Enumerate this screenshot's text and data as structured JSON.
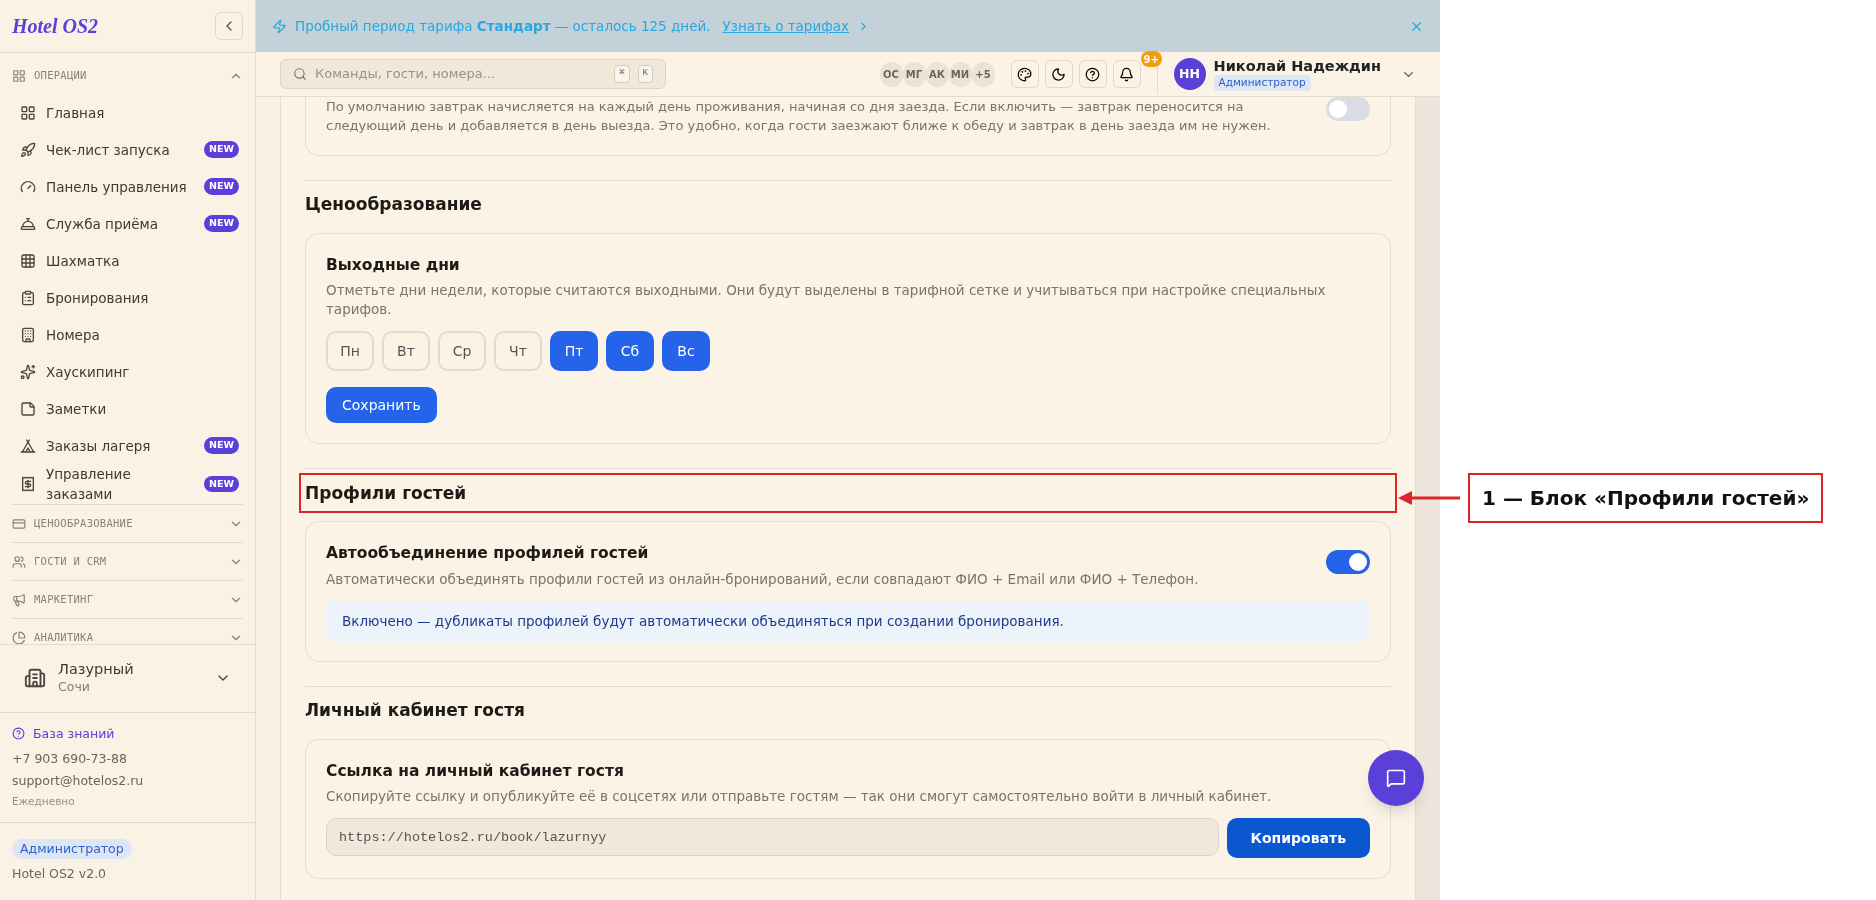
{
  "sidebar": {
    "logo": "Hotel OS2",
    "groups": [
      {
        "label": "ОПЕРАЦИИ",
        "expanded": true,
        "items": [
          {
            "label": "Главная"
          },
          {
            "label": "Чек-лист запуска",
            "badge": "NEW"
          },
          {
            "label": "Панель управления",
            "badge": "NEW"
          },
          {
            "label": "Служба приёма",
            "badge": "NEW"
          },
          {
            "label": "Шахматка"
          },
          {
            "label": "Бронирования"
          },
          {
            "label": "Номера"
          },
          {
            "label": "Хаускипинг"
          },
          {
            "label": "Заметки"
          },
          {
            "label": "Заказы лагеря",
            "badge": "NEW"
          },
          {
            "label": "Управление заказами",
            "badge": "NEW"
          }
        ]
      },
      {
        "label": "ЦЕНООБРАЗОВАНИЕ",
        "expanded": false
      },
      {
        "label": "ГОСТИ И CRM",
        "expanded": false
      },
      {
        "label": "МАРКЕТИНГ",
        "expanded": false
      },
      {
        "label": "АНАЛИТИКА",
        "expanded": false
      }
    ],
    "property": {
      "name": "Лазурный",
      "city": "Сочи"
    },
    "support": {
      "link": "База знаний",
      "phone": "+7 903 690-73-88",
      "email": "support@hotelos2.ru",
      "hours": "Ежедневно"
    },
    "role": "Администратор",
    "version": "Hotel OS2 v2.0"
  },
  "banner": {
    "text": "Пробный период тарифа **Стандарт** — осталось 125 дней.",
    "link": "Узнать о тарифах"
  },
  "header": {
    "search_placeholder": "Команды, гости, номера...",
    "shortcut": [
      "⌘",
      "K"
    ],
    "avatars": [
      "ОС",
      "МГ",
      "АК",
      "МИ",
      "+5"
    ],
    "notifications_badge": "9+",
    "user": {
      "initials": "НН",
      "name": "Николай Надеждин",
      "role": "Администратор"
    }
  },
  "sections": [
    {
      "kind": "tail",
      "description": "По умолчанию завтрак начисляется на каждый день проживания, начиная со дня заезда. Если включить — завтрак переносится на следующий день и добавляется в день выезда. Это удобно, когда гости заезжают ближе к обеду и завтрак в день заезда им не нужен.",
      "on": false
    },
    {
      "kind": "weekdays",
      "heading": "Ценообразование",
      "annotated": false,
      "title": "Выходные дни",
      "description": "Отметьте дни недели, которые считаются выходными. Они будут выделены в тарифной сетке и учитываться при настройке специальных тарифов.",
      "days": [
        {
          "label": "Пн",
          "selected": false
        },
        {
          "label": "Вт",
          "selected": false
        },
        {
          "label": "Ср",
          "selected": false
        },
        {
          "label": "Чт",
          "selected": false
        },
        {
          "label": "Пт",
          "selected": true
        },
        {
          "label": "Сб",
          "selected": true
        },
        {
          "label": "Вс",
          "selected": true
        }
      ],
      "button": "Сохранить"
    },
    {
      "kind": "toggle",
      "heading": "Профили гостей",
      "annotated": true,
      "title": "Автообъединение профилей гостей",
      "description": "Автоматически объединять профили гостей из онлайн-бронирований, если совпадают ФИО + Email или ФИО + Телефон.",
      "on": true,
      "note": "Включено — дубликаты профилей будут автоматически объединяться при создании бронирования."
    },
    {
      "kind": "link",
      "heading": "Личный кабинет гостя",
      "annotated": false,
      "title": "Ссылка на личный кабинет гостя",
      "description": "Скопируйте ссылку и опубликуйте её в соцсетях или отправьте гостям — так они смогут самостоятельно войти в личный кабинет.",
      "value": "https://hotelos2.ru/book/lazurnyy",
      "button": "Копировать"
    }
  ],
  "annotation": {
    "text": "1 — Блок «Профили гостей»"
  }
}
